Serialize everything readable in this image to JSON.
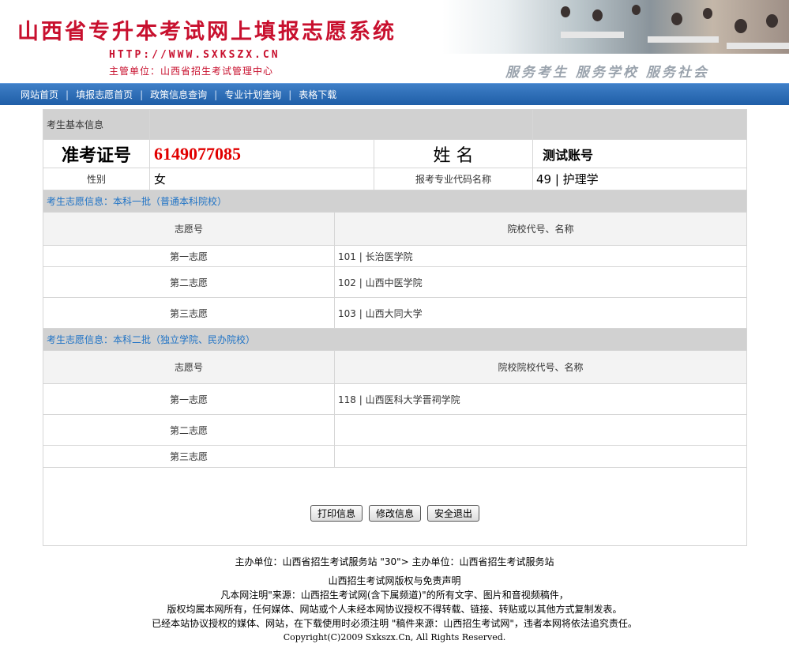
{
  "header": {
    "title": "山西省专升本考试网上填报志愿系统",
    "url": "HTTP://WWW.SXKSZX.CN",
    "org": "主管单位：山西省招生考试管理中心",
    "slogan": "服务考生  服务学校  服务社会"
  },
  "nav": {
    "items": [
      "网站首页",
      "填报志愿首页",
      "政策信息查询",
      "专业计划查询",
      "表格下载"
    ]
  },
  "basic": {
    "section_title": "考生基本信息",
    "exam_no_label": "准考证号",
    "exam_no_value": "6149077085",
    "name_label": "姓 名",
    "name_value": "测试账号",
    "gender_label": "性别",
    "gender_value": "女",
    "major_label": "报考专业代码名称",
    "major_value": "49 | 护理学"
  },
  "batch1": {
    "title": "考生志愿信息：本科一批（普通本科院校）",
    "col1": "志愿号",
    "col2": "院校代号、名称",
    "rows": [
      {
        "choice": "第一志愿",
        "school": "101 | 长治医学院"
      },
      {
        "choice": "第二志愿",
        "school": "102 | 山西中医学院"
      },
      {
        "choice": "第三志愿",
        "school": "103 | 山西大同大学"
      }
    ]
  },
  "batch2": {
    "title": "考生志愿信息：本科二批（独立学院、民办院校）",
    "col1": "志愿号",
    "col2": "院校院校代号、名称",
    "rows": [
      {
        "choice": "第一志愿",
        "school": "118 | 山西医科大学晋祠学院"
      },
      {
        "choice": "第二志愿",
        "school": ""
      },
      {
        "choice": "第三志愿",
        "school": ""
      }
    ]
  },
  "buttons": {
    "print": "打印信息",
    "modify": "修改信息",
    "logout": "安全退出"
  },
  "footer": {
    "line1": "主办单位：山西省招生考试服务站 \"30\"> 主办单位：山西省招生考试服务站",
    "line2": "山西招生考试网版权与免责声明",
    "line3": "凡本网注明\"来源：山西招生考试网(含下属频道)\"的所有文字、图片和音视频稿件，",
    "line4": "版权均属本网所有，任何媒体、网站或个人未经本网协议授权不得转载、链接、转贴或以其他方式复制发表。",
    "line5": "已经本站协议授权的媒体、网站，在下载使用时必须注明 \"稿件来源：山西招生考试网\"，违者本网将依法追究责任。",
    "copyright": "Copyright(C)2009 Sxkszx.Cn, All Rights Reserved."
  },
  "colors": {
    "brand_red": "#c8102e",
    "nav_blue": "#1f5ea7",
    "section_blue": "#1f73c6",
    "exam_no_red": "#e10000"
  }
}
